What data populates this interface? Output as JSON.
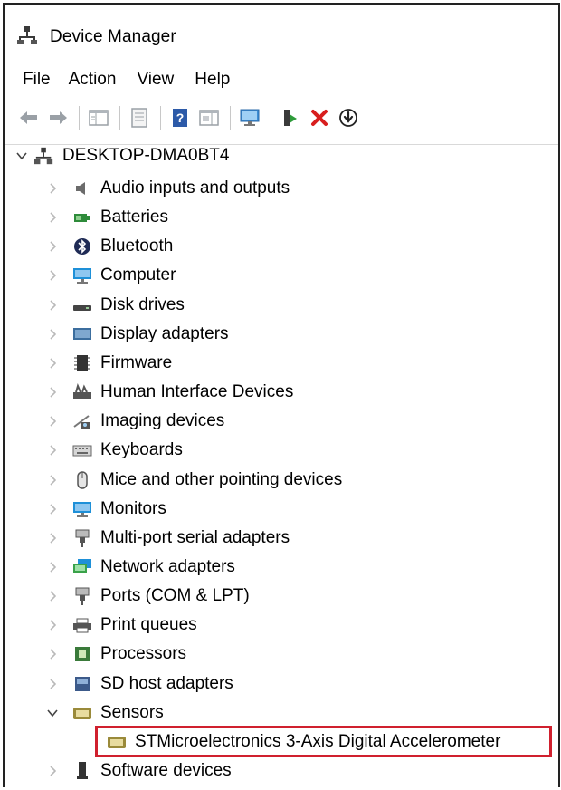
{
  "window": {
    "title": "Device Manager"
  },
  "menu": [
    "File",
    "Action",
    "View",
    "Help"
  ],
  "toolbar": [
    "back-arrow-icon",
    "forward-arrow-icon",
    "show-hide-tree-icon",
    "properties-icon",
    "help-icon",
    "view-resources-icon",
    "scan-hardware-icon",
    "update-driver-icon",
    "uninstall-x-icon",
    "disable-device-icon"
  ],
  "tree": {
    "root": "DESKTOP-DMA0BT4",
    "categories": [
      {
        "label": "Audio inputs and outputs",
        "icon": "speaker-icon",
        "color": "#6b6b6b"
      },
      {
        "label": "Batteries",
        "icon": "battery-icon",
        "color": "#2e8b3a"
      },
      {
        "label": "Bluetooth",
        "icon": "bluetooth-icon",
        "color": "#1f2b55"
      },
      {
        "label": "Computer",
        "icon": "monitor-icon",
        "color": "#1e90d8"
      },
      {
        "label": "Disk drives",
        "icon": "disk-drive-icon",
        "color": "#444444"
      },
      {
        "label": "Display adapters",
        "icon": "display-adapter-icon",
        "color": "#3c6e9e"
      },
      {
        "label": "Firmware",
        "icon": "chip-icon",
        "color": "#333333"
      },
      {
        "label": "Human Interface Devices",
        "icon": "hid-icon",
        "color": "#555555"
      },
      {
        "label": "Imaging devices",
        "icon": "camera-icon",
        "color": "#555555"
      },
      {
        "label": "Keyboards",
        "icon": "keyboard-icon",
        "color": "#666666"
      },
      {
        "label": "Mice and other pointing devices",
        "icon": "mouse-icon",
        "color": "#555555"
      },
      {
        "label": "Monitors",
        "icon": "monitor-icon",
        "color": "#1e90d8"
      },
      {
        "label": "Multi-port serial adapters",
        "icon": "serial-port-icon",
        "color": "#555555"
      },
      {
        "label": "Network adapters",
        "icon": "network-icon",
        "color": "#1e90d8"
      },
      {
        "label": "Ports (COM & LPT)",
        "icon": "port-icon",
        "color": "#555555"
      },
      {
        "label": "Print queues",
        "icon": "printer-icon",
        "color": "#555555"
      },
      {
        "label": "Processors",
        "icon": "processor-icon",
        "color": "#3a7a3a"
      },
      {
        "label": "SD host adapters",
        "icon": "sd-card-icon",
        "color": "#3c5a8a"
      },
      {
        "label": "Sensors",
        "icon": "sensor-icon",
        "color": "#9a8a3a",
        "expanded": true
      },
      {
        "label": "STMicroelectronics 3-Axis Digital Accelerometer",
        "icon": "sensor-icon",
        "color": "#9a8a3a",
        "child": true,
        "highlighted": true
      },
      {
        "label": "Software devices",
        "icon": "software-device-icon",
        "color": "#333333"
      }
    ]
  },
  "highlight_color": "#d0202e"
}
